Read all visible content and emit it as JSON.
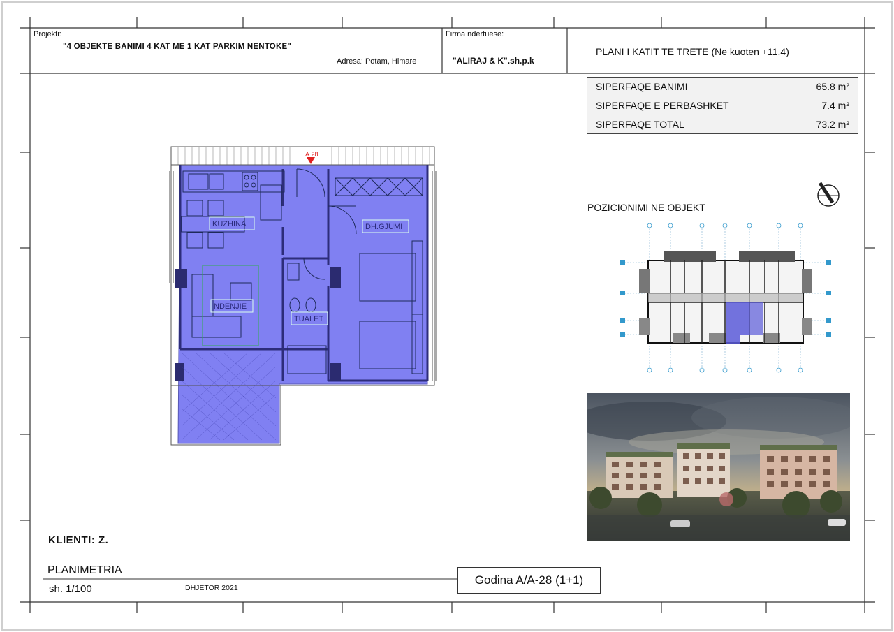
{
  "header": {
    "projekti_label": "Projekti:",
    "projekti_value": "\"4 OBJEKTE BANIMI 4 KAT  ME 1 KAT  PARKIM  NENTOKE\"",
    "adresa": "Adresa: Potam, Himare",
    "firma_label": "Firma ndertuese:",
    "firma_value": "\"ALIRAJ & K\".sh.p.k",
    "plan_title": "PLANI I KATIT TE TRETE (Ne kuoten +11.4)"
  },
  "areas": [
    {
      "label": "SIPERFAQE BANIMI",
      "value": "65.8 m²"
    },
    {
      "label": "SIPERFAQE E PERBASHKET",
      "value": "7.4 m²"
    },
    {
      "label": "SIPERFAQE TOTAL",
      "value": "73.2 m²"
    }
  ],
  "pozicionimi": "POZICIONIMI NE OBJEKT",
  "floorplan": {
    "unit_tag": "A.28",
    "rooms": {
      "kuzhina": "KUZHINA",
      "dhgjumi": "DH.GJUMI",
      "ndenjie": "NDENJIE",
      "tualet": "TUALET"
    }
  },
  "footer": {
    "klienti": "KLIENTI: Z.",
    "planimetria": "PLANIMETRIA",
    "scale": "sh. 1/100",
    "date": "DHJETOR  2021",
    "godina": "Godina A/A-28 (1+1)"
  },
  "colors": {
    "unit_fill": "#6b6bf0",
    "highlight": "#5a5ad8",
    "tag_red": "#e02020"
  }
}
